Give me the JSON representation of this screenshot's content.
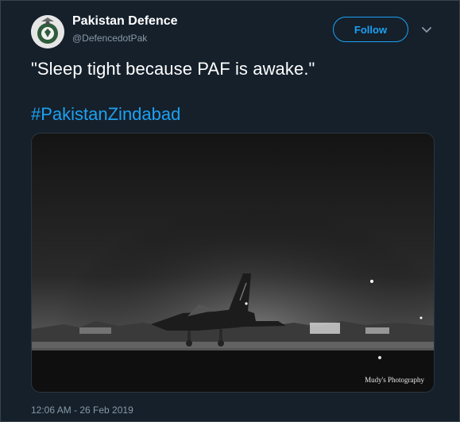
{
  "author": {
    "name": "Pakistan Defence",
    "handle": "@DefencedotPak"
  },
  "actions": {
    "follow_label": "Follow"
  },
  "tweet": {
    "text": "\"Sleep tight because PAF is awake.\"",
    "hashtag": "#PakistanZindabad",
    "timestamp": "12:06 AM - 26 Feb 2019"
  },
  "media": {
    "watermark": "Mudy's Photography"
  },
  "colors": {
    "background": "#15202b",
    "accent": "#1da1f2",
    "secondary_text": "#8899a6"
  },
  "icons": {
    "avatar": "pakistan-defence-emblem",
    "caret": "chevron-down-icon"
  }
}
